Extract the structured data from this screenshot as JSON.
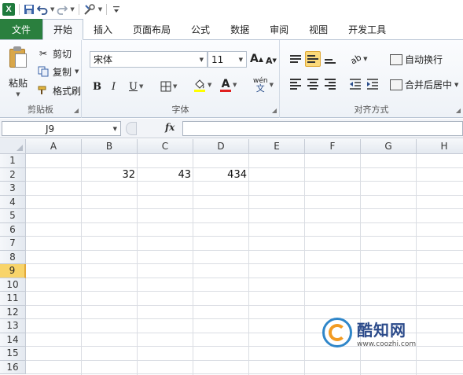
{
  "quick_access": {
    "save_icon": "save-icon",
    "undo_icon": "undo-icon",
    "redo_icon": "redo-icon"
  },
  "tabs": {
    "file": "文件",
    "items": [
      "开始",
      "插入",
      "页面布局",
      "公式",
      "数据",
      "审阅",
      "视图",
      "开发工具"
    ],
    "active_index": 0,
    "file_color": "#2a7f3e"
  },
  "ribbon": {
    "clipboard": {
      "paste": "粘贴",
      "cut": "剪切",
      "copy": "复制",
      "format_painter": "格式刷",
      "label": "剪贴板"
    },
    "font": {
      "font_name": "宋体",
      "font_size": "11",
      "grow": "A",
      "shrink": "A",
      "bold": "B",
      "italic": "I",
      "underline": "U",
      "font_color_letter": "A",
      "phonetic": "wén",
      "label": "字体",
      "fill_color": "#ffff00",
      "font_color": "#e02020"
    },
    "alignment": {
      "wrap_text": "自动换行",
      "merge_center": "合并后居中",
      "label": "对齐方式",
      "active_button": "middle-align"
    }
  },
  "formula_bar": {
    "name_box": "J9",
    "fx": "fx",
    "formula": ""
  },
  "sheet": {
    "columns": [
      "A",
      "B",
      "C",
      "D",
      "E",
      "F",
      "G",
      "H"
    ],
    "rows": [
      "1",
      "2",
      "3",
      "4",
      "5",
      "6",
      "7",
      "8",
      "9",
      "10",
      "11",
      "12",
      "13",
      "14",
      "15",
      "16"
    ],
    "selected_row": "9",
    "cells": {
      "B2": "32",
      "C2": "43",
      "D2": "434"
    }
  },
  "watermark": {
    "name": "酷知网",
    "url": "www.coozhi.com"
  }
}
